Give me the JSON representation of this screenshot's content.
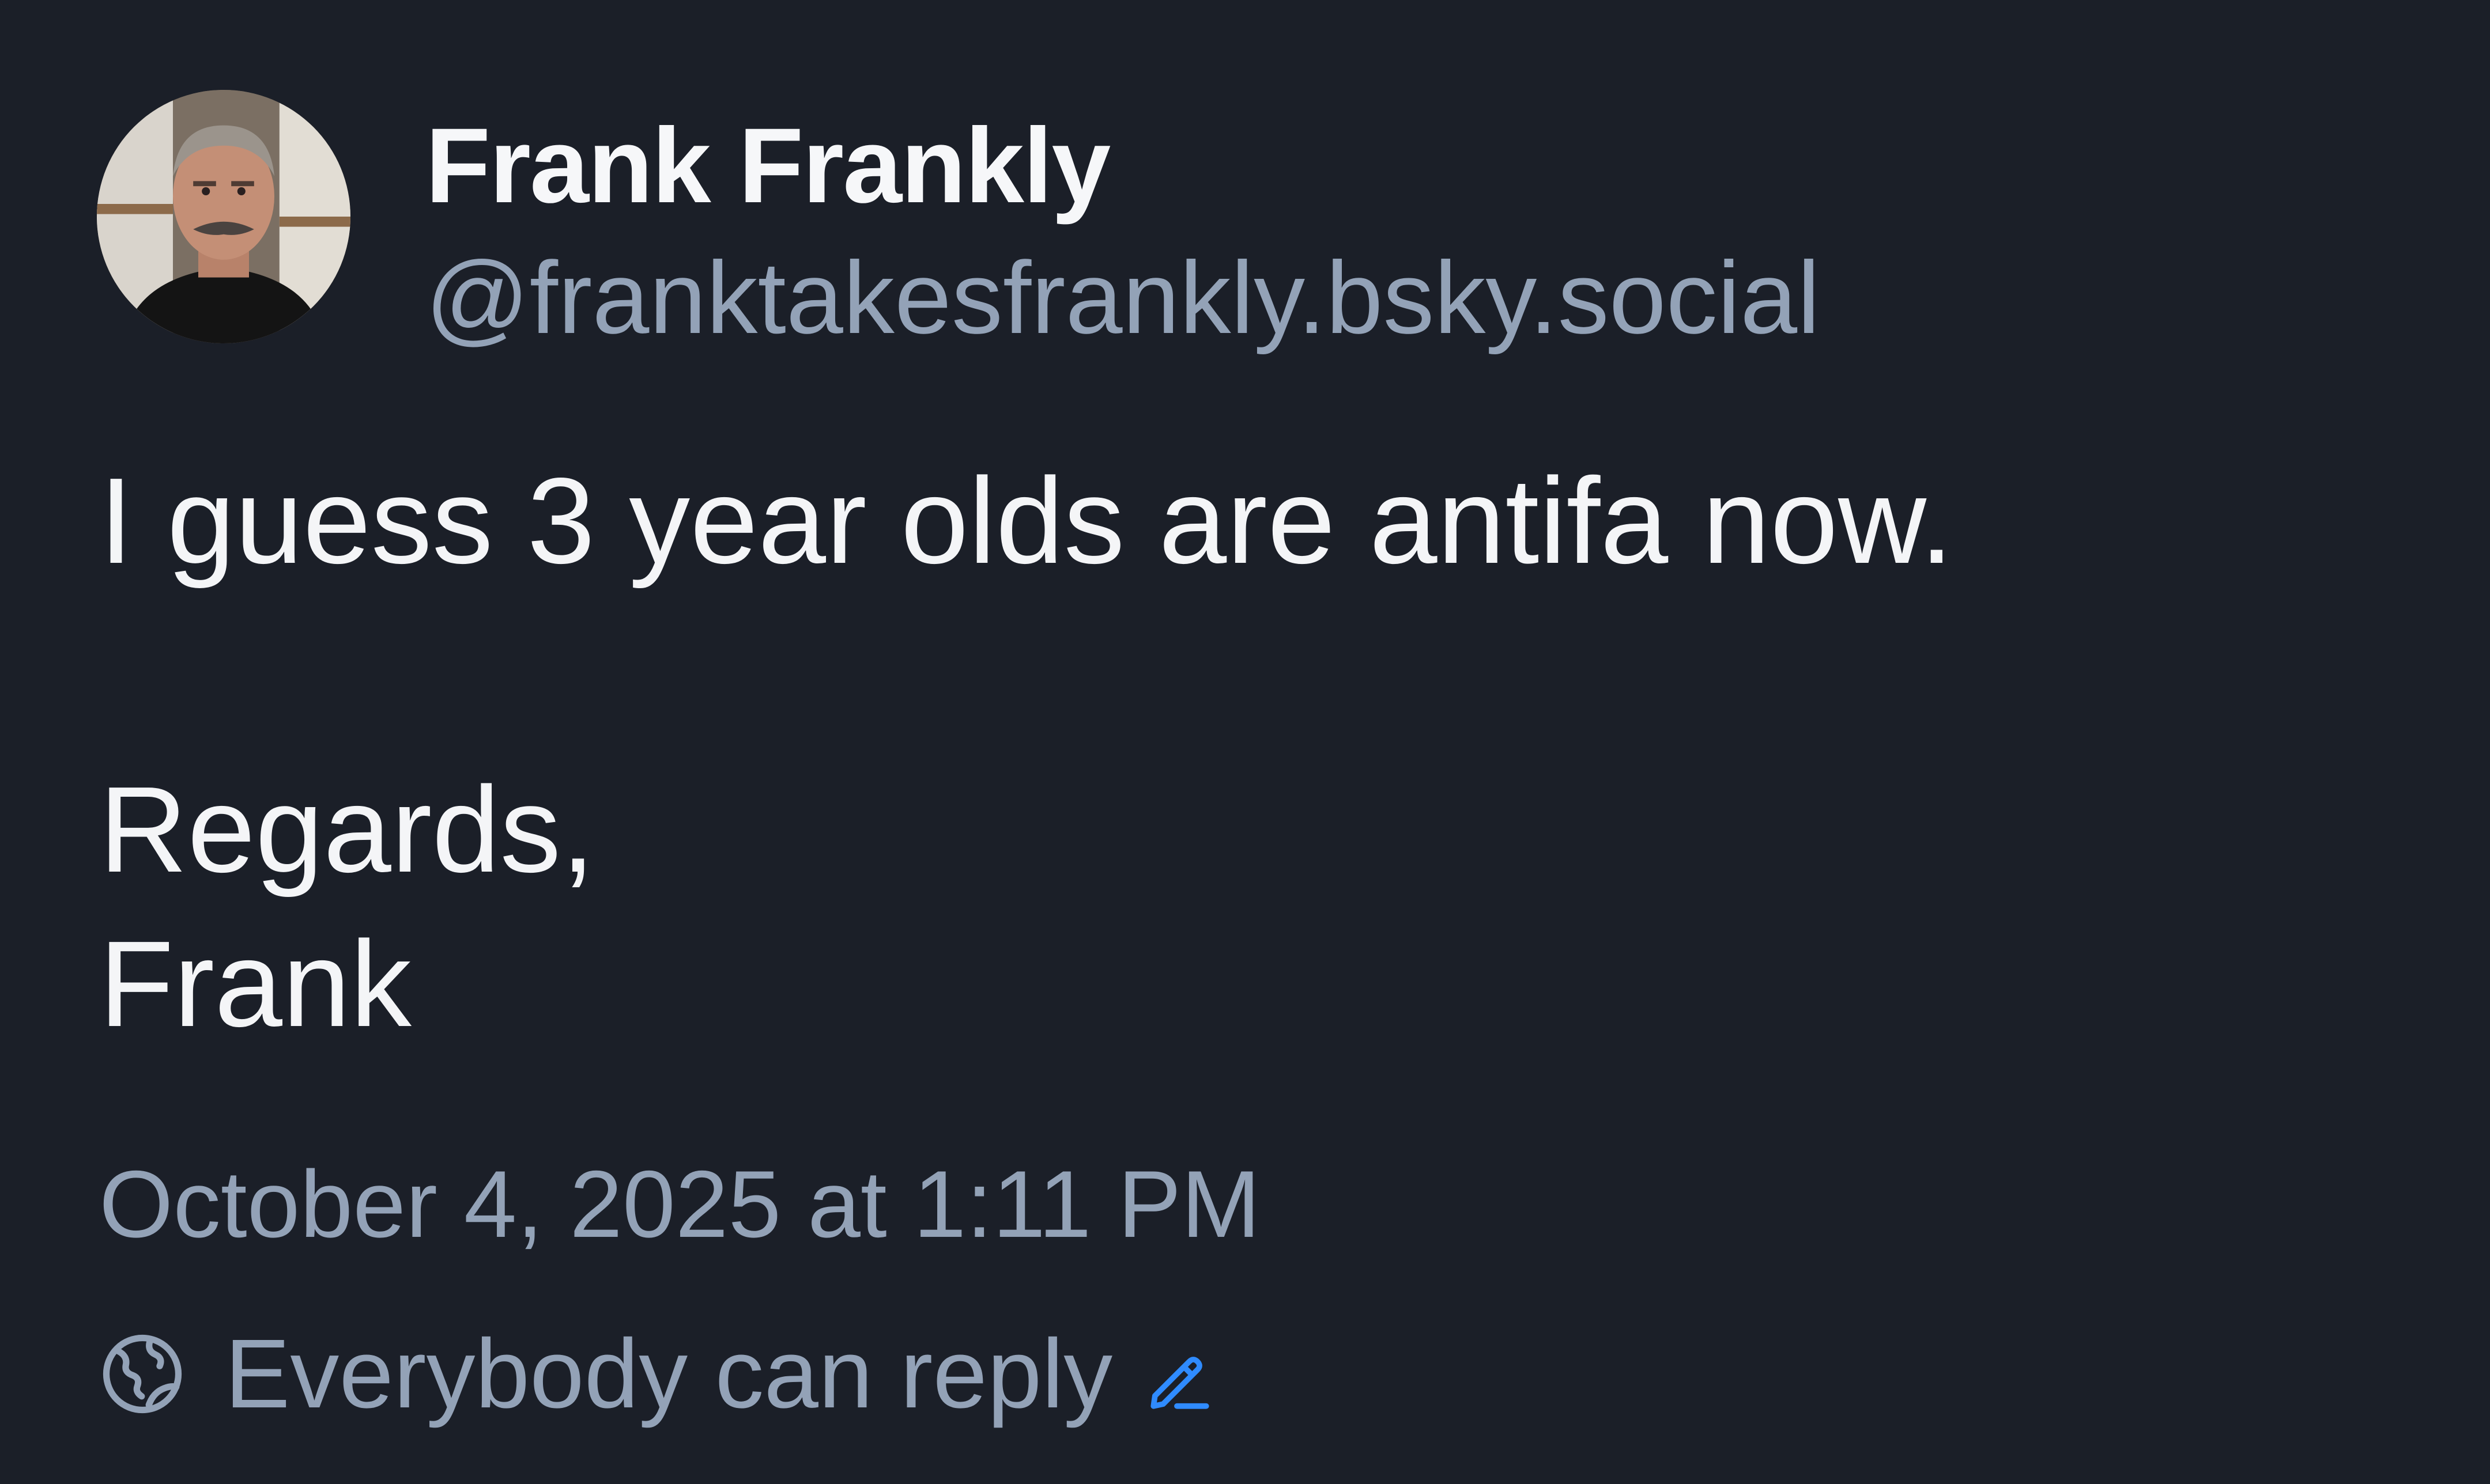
{
  "author": {
    "display_name": "Frank Frankly",
    "handle": "@franktakesfrankly.bsky.social"
  },
  "post": {
    "line_1": "I guess 3 year olds are antifa now.",
    "line_2": "Regards,",
    "line_3": "Frank",
    "timestamp": "October 4, 2025 at 1:11 PM"
  },
  "reply_settings": {
    "label": "Everybody can reply",
    "globe_icon": "globe-icon",
    "edit_icon": "pencil-icon"
  },
  "colors": {
    "background": "#1b1f28",
    "text": "#f4f5f7",
    "muted": "#93a2b7",
    "accent": "#2f8bff"
  }
}
